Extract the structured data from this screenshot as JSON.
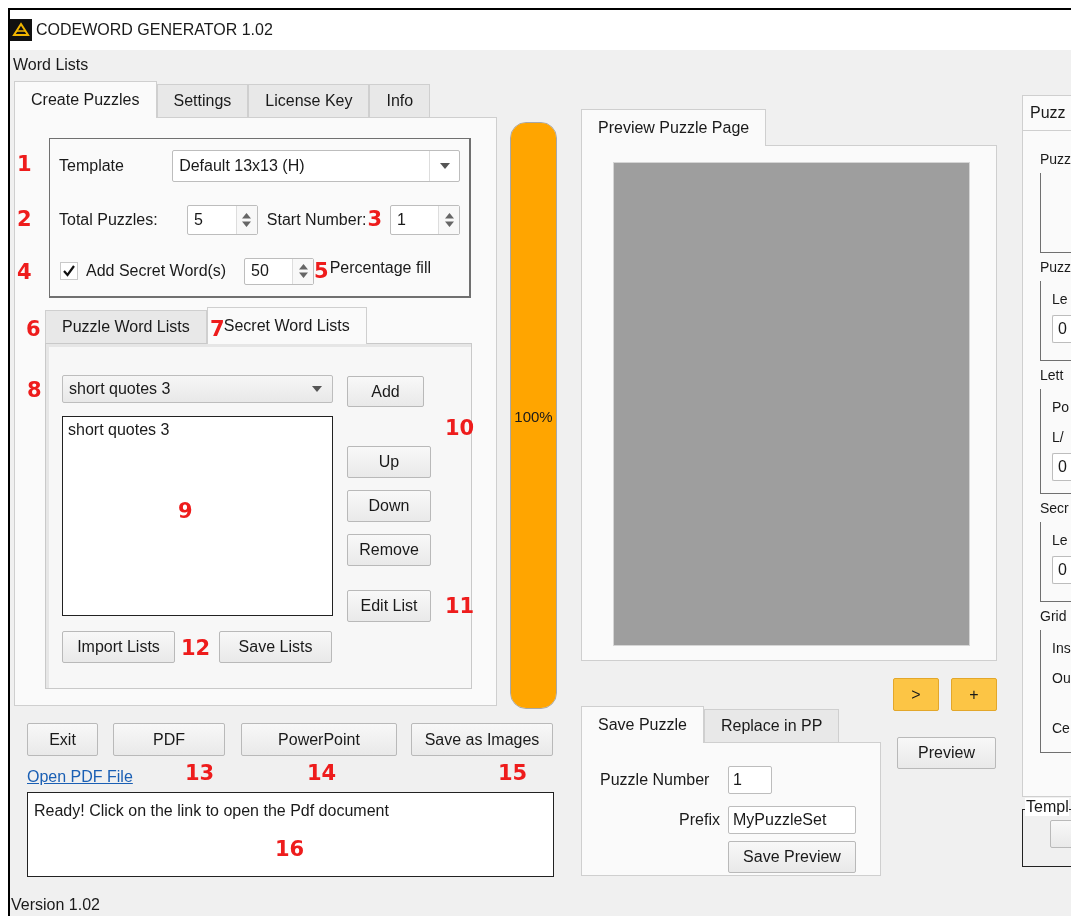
{
  "window": {
    "title": "CODEWORD GENERATOR 1.02"
  },
  "menu": [
    "Word Lists"
  ],
  "main_tabs": [
    {
      "label": "Create Puzzles",
      "selected": true
    },
    {
      "label": "Settings",
      "selected": false
    },
    {
      "label": "License Key",
      "selected": false
    },
    {
      "label": "Info",
      "selected": false
    }
  ],
  "template": {
    "marker": "1",
    "label": "Template",
    "value": "Default 13x13 (H)"
  },
  "total_puzzles": {
    "marker": "2",
    "label": "Total Puzzles:",
    "value": "5"
  },
  "start_number": {
    "label": "Start Number:",
    "marker": "3",
    "value": "1"
  },
  "secret_words": {
    "marker": "4",
    "label": "Add Secret Word(s)",
    "checked": true,
    "value": "50",
    "value_marker": "5",
    "suffix": "Percentage fill"
  },
  "list_tabs": [
    {
      "marker": "6",
      "label": "Puzzle Word Lists",
      "selected": false
    },
    {
      "marker": "7",
      "label": "Secret Word Lists",
      "selected": true
    }
  ],
  "list_select": {
    "marker": "8",
    "value": "short quotes 3"
  },
  "add_button": "Add",
  "list_box": {
    "marker": "9",
    "items": [
      "short quotes 3"
    ]
  },
  "buttons_marker": "10",
  "side_buttons": [
    "Up",
    "Down",
    "Remove"
  ],
  "edit_button": {
    "label": "Edit List",
    "marker": "11"
  },
  "import_button": {
    "label": "Import Lists",
    "marker": "12"
  },
  "save_lists_button": "Save Lists",
  "progress": {
    "level": 1,
    "reading": "100%"
  },
  "actions": [
    {
      "label": "Exit"
    },
    {
      "label": "PDF",
      "marker": "13"
    },
    {
      "label": "PowerPoint",
      "marker": "14"
    },
    {
      "label": "Save as Images",
      "marker": "15"
    }
  ],
  "pdf_link": "Open PDF File",
  "status": {
    "text": "Ready! Click on the link to open the Pdf document",
    "marker": "16"
  },
  "version": "Version 1.02",
  "preview_tabs": [
    {
      "label": "Preview Puzzle Page",
      "selected": true
    }
  ],
  "nav_buttons": [
    ">",
    "+"
  ],
  "preview_button": "Preview",
  "save_tabs": [
    {
      "label": "Save Puzzle",
      "selected": true
    },
    {
      "label": "Replace in PP",
      "selected": false
    }
  ],
  "puzzle_number": {
    "label": "Puzzle Number",
    "value": "1"
  },
  "prefix": {
    "label": "Prefix",
    "value": "MyPuzzleSet"
  },
  "save_preview_button": "Save Preview",
  "right_panel": {
    "tabs": [
      {
        "label": "Puzz",
        "selected": true
      }
    ],
    "groups": [
      {
        "title": "Puzz"
      },
      {
        "title": "Puzz",
        "rows": [
          {
            "kind": "label",
            "text": "Le"
          },
          {
            "kind": "field",
            "text": "0"
          }
        ]
      },
      {
        "title": "Lett",
        "rows": [
          {
            "kind": "label",
            "text": "Po"
          },
          {
            "kind": "label",
            "text": "L/"
          },
          {
            "kind": "field",
            "text": "0"
          }
        ]
      },
      {
        "title": "Secr",
        "rows": [
          {
            "kind": "label",
            "text": "Le"
          },
          {
            "kind": "field",
            "text": "0"
          }
        ]
      },
      {
        "title": "Grid",
        "rows": [
          {
            "kind": "label",
            "text": "Ins"
          },
          {
            "kind": "label",
            "text": "Ou"
          },
          {
            "kind": "gap"
          },
          {
            "kind": "label",
            "text": "Ce"
          }
        ]
      }
    ],
    "template_group": "Templ"
  }
}
